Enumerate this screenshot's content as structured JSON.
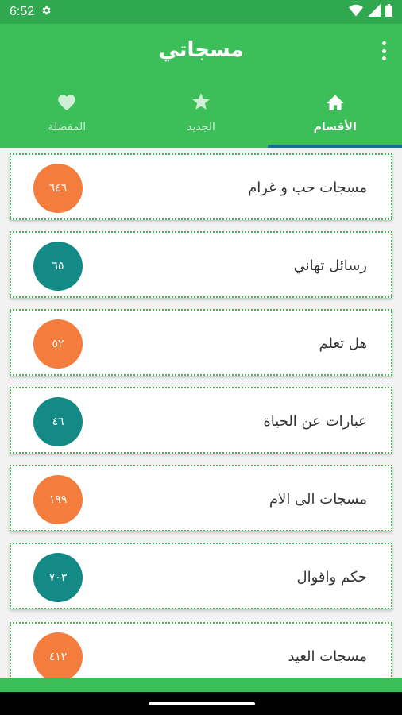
{
  "status": {
    "time": "6:52"
  },
  "app": {
    "title": "مسجاتي"
  },
  "tabs": [
    {
      "label": "المفضلة",
      "icon": "heart-icon"
    },
    {
      "label": "الجديد",
      "icon": "star-icon"
    },
    {
      "label": "الأقسام",
      "icon": "home-icon",
      "active": true
    }
  ],
  "categories": [
    {
      "name": "مسجات حب و غرام",
      "count": "٦٤٦",
      "color": "#f47c3c"
    },
    {
      "name": "رسائل تهاني",
      "count": "٦٥",
      "color": "#138a86"
    },
    {
      "name": "هل تعلم",
      "count": "٥٢",
      "color": "#f47c3c"
    },
    {
      "name": "عبارات عن الحياة",
      "count": "٤٦",
      "color": "#138a86"
    },
    {
      "name": "مسجات الى الام",
      "count": "١٩٩",
      "color": "#f47c3c"
    },
    {
      "name": "حكم واقوال",
      "count": "٧٠٣",
      "color": "#138a86"
    },
    {
      "name": "مسجات العيد",
      "count": "٤١٢",
      "color": "#f47c3c"
    }
  ],
  "colors": {
    "primary": "#3cbe59",
    "status": "#2fa84f",
    "indicator": "#1d6e8a",
    "orange": "#f47c3c",
    "teal": "#138a86"
  }
}
